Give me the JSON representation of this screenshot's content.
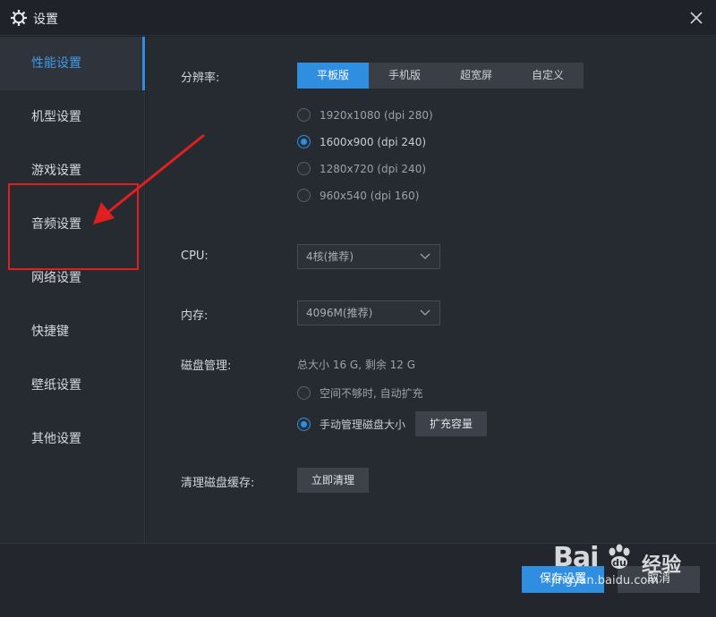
{
  "window": {
    "title": "设置"
  },
  "sidebar": {
    "items": [
      {
        "label": "性能设置",
        "active": true
      },
      {
        "label": "机型设置"
      },
      {
        "label": "游戏设置"
      },
      {
        "label": "音频设置"
      },
      {
        "label": "网络设置"
      },
      {
        "label": "快捷键"
      },
      {
        "label": "壁纸设置"
      },
      {
        "label": "其他设置"
      }
    ]
  },
  "resolution": {
    "label": "分辨率:",
    "modes": [
      "平板版",
      "手机版",
      "超宽屏",
      "自定义"
    ],
    "selected_mode": "平板版",
    "options": [
      "1920x1080 (dpi 280)",
      "1600x900 (dpi 240)",
      "1280x720 (dpi 240)",
      "960x540 (dpi 160)"
    ],
    "selected_option": "1600x900 (dpi 240)"
  },
  "cpu": {
    "label": "CPU:",
    "value": "4核(推荐)"
  },
  "memory": {
    "label": "内存:",
    "value": "4096M(推荐)"
  },
  "disk": {
    "label": "磁盘管理:",
    "info": "总大小 16 G, 剩余 12 G",
    "options": [
      "空间不够时, 自动扩充",
      "手动管理磁盘大小"
    ],
    "selected_option": "手动管理磁盘大小",
    "expand_button": "扩充容量"
  },
  "cache": {
    "label": "清理磁盘缓存:",
    "button": "立即清理"
  },
  "footer": {
    "save": "保存设置",
    "cancel": "取消"
  },
  "watermark": {
    "logo": "Bai",
    "brand": "经验",
    "url": "jingyan.baidu.com"
  },
  "colors": {
    "accent": "#2f8ee0",
    "annotation": "#e02020",
    "background": "#262a31"
  }
}
